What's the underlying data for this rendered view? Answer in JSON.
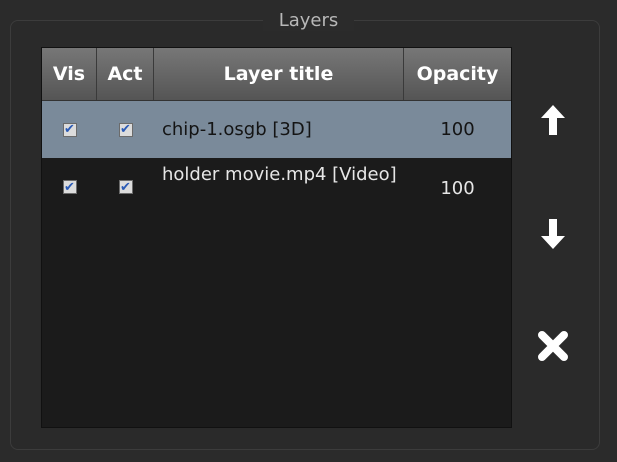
{
  "panel": {
    "title": "Layers"
  },
  "table": {
    "headers": {
      "vis": "Vis",
      "act": "Act",
      "title": "Layer title",
      "opacity": "Opacity"
    },
    "rows": [
      {
        "visible": true,
        "active": true,
        "title": "chip-1.osgb [3D]",
        "opacity": "100",
        "selected": true
      },
      {
        "visible": true,
        "active": true,
        "title": "holder movie.mp4 [Video]",
        "opacity": "100",
        "selected": false
      }
    ]
  },
  "buttons": [
    {
      "icon": "arrow-up-icon"
    },
    {
      "icon": "arrow-down-icon"
    },
    {
      "icon": "delete-x-icon"
    }
  ],
  "colors": {
    "selected_row": "#7a8a9a",
    "background": "#2b2b2b",
    "table_bg": "#1b1b1b",
    "check": "#2a5ab5"
  }
}
